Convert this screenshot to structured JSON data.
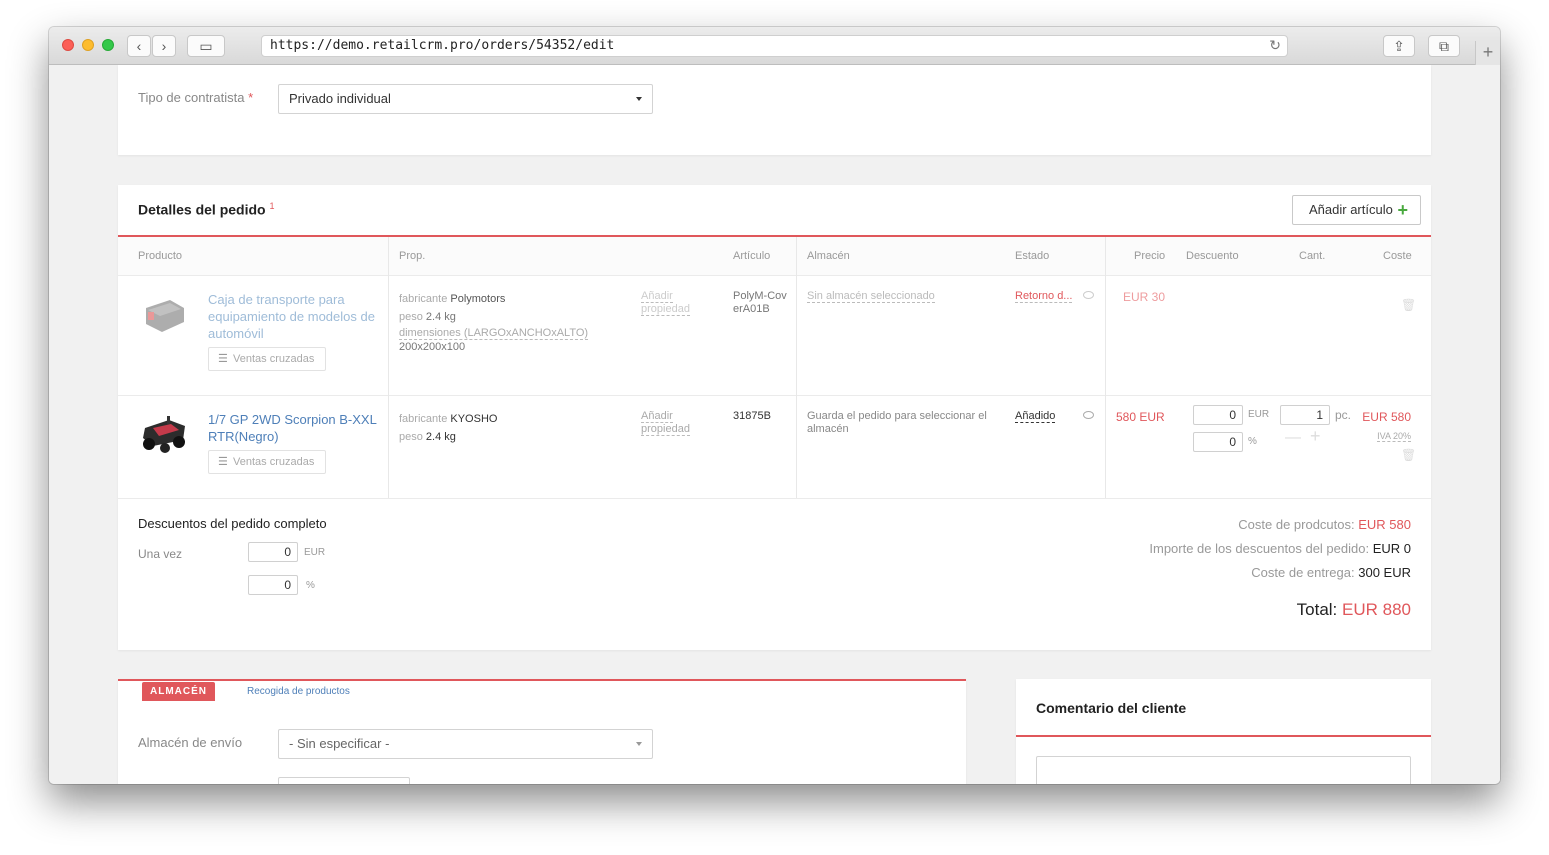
{
  "browser": {
    "url": "https://demo.retailcrm.pro/orders/54352/edit",
    "back_glyph": "‹",
    "forward_glyph": "›",
    "sidebar_glyph": "▭",
    "reload_glyph": "↻",
    "share_glyph": "⇪",
    "tabs_glyph": "⧉",
    "newtab_glyph": "+"
  },
  "contractor": {
    "label": "Tipo de contratista",
    "required_mark": "*",
    "value": "Privado individual"
  },
  "order_details": {
    "title": "Detalles del pedido",
    "count": "1",
    "add_button": "Añadir artículo",
    "add_icon": "+",
    "columns": {
      "producto": "Producto",
      "prop": "Prop.",
      "articulo": "Artículo",
      "almacen": "Almacén",
      "estado": "Estado",
      "precio": "Precio",
      "descuento": "Descuento",
      "cant": "Cant.",
      "coste": "Coste"
    },
    "items": [
      {
        "name": "Caja de transporte para equipamiento de modelos de automóvil",
        "cross_sales": "Ventas cruzadas",
        "props": [
          {
            "key": "fabricante",
            "value": "Polymotors"
          },
          {
            "key": "peso",
            "value": "2.4 kg"
          },
          {
            "key": "dimensiones (LARGOxANCHOxALTO)",
            "value": "200x200x100"
          }
        ],
        "add_prop": "Añadir propiedad",
        "article": "PolyM-CoverA01B",
        "warehouse": "Sin almacén seleccionado",
        "status": "Retorno d...",
        "price": "EUR 30"
      },
      {
        "name": "1/7 GP 2WD Scorpion B-XXL RTR(Negro)",
        "cross_sales": "Ventas cruzadas",
        "props": [
          {
            "key": "fabricante",
            "value": "KYOSHO"
          },
          {
            "key": "peso",
            "value": "2.4 kg"
          }
        ],
        "add_prop": "Añadir propiedad",
        "article": "31875B",
        "warehouse": "Guarda el pedido para seleccionar el almacén",
        "status": "Añadido",
        "price": "580 EUR",
        "discount_amount": "0",
        "discount_currency": "EUR",
        "discount_percent": "0",
        "percent_sign": "%",
        "quantity": "1",
        "quantity_unit": "pc.",
        "cost": "EUR 580",
        "vat": "IVA 20%"
      }
    ],
    "order_discounts": {
      "title": "Descuentos del pedido completo",
      "once_label": "Una vez",
      "amount": "0",
      "currency": "EUR",
      "percent": "0",
      "percent_sign": "%"
    },
    "totals": {
      "products_cost_label": "Coste de prodcutos:",
      "products_cost": "EUR 580",
      "discounts_label": "Importe de los descuentos del pedido:",
      "discounts": "EUR 0",
      "delivery_label": "Coste de entrega:",
      "delivery": "300 EUR",
      "total_label": "Total:",
      "total": "EUR 880"
    }
  },
  "warehouse": {
    "tab_active": "ALMACÉN",
    "tab_link": "Recogida de productos",
    "label": "Almacén de envío",
    "value": "- Sin especificar -"
  },
  "comment": {
    "title": "Comentario del cliente"
  }
}
